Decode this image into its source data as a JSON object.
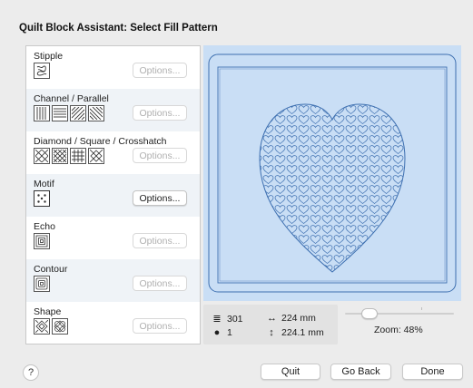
{
  "dialog": {
    "title": "Quilt Block Assistant: Select Fill Pattern"
  },
  "patterns": [
    {
      "label": "Stipple",
      "thumbs": [
        "stipple-icon"
      ],
      "options_label": "Options...",
      "options_enabled": false
    },
    {
      "label": "Channel / Parallel",
      "thumbs": [
        "vertical-lines-icon",
        "horizontal-lines-icon",
        "diagonal-lines-icon",
        "diagonal-lines-reverse-icon"
      ],
      "options_label": "Options...",
      "options_enabled": false
    },
    {
      "label": "Diamond / Square / Crosshatch",
      "thumbs": [
        "diamond-icon",
        "crosshatch-diagonal-icon",
        "grid-icon",
        "diamond-outline-icon"
      ],
      "options_label": "Options...",
      "options_enabled": false
    },
    {
      "label": "Motif",
      "thumbs": [
        "motif-icon"
      ],
      "options_label": "Options...",
      "options_enabled": true
    },
    {
      "label": "Echo",
      "thumbs": [
        "echo-icon"
      ],
      "options_label": "Options...",
      "options_enabled": false
    },
    {
      "label": "Contour",
      "thumbs": [
        "contour-icon"
      ],
      "options_label": "Options...",
      "options_enabled": false
    },
    {
      "label": "Shape",
      "thumbs": [
        "shape-diamond-icon",
        "shape-circles-icon"
      ],
      "options_label": "Options...",
      "options_enabled": false
    }
  ],
  "stats": {
    "stitch_count": "301",
    "width": "224 mm",
    "colors": "1",
    "height": "224.1 mm"
  },
  "zoom": {
    "label": "Zoom: 48%",
    "value_percent": 48
  },
  "footer": {
    "help_label": "?",
    "quit_label": "Quit",
    "go_back_label": "Go Back",
    "done_label": "Done"
  },
  "colors": {
    "preview_bg": "#c9def5",
    "stitch_line": "#3d6fb0",
    "panel_alt_row": "#eff3f7"
  }
}
